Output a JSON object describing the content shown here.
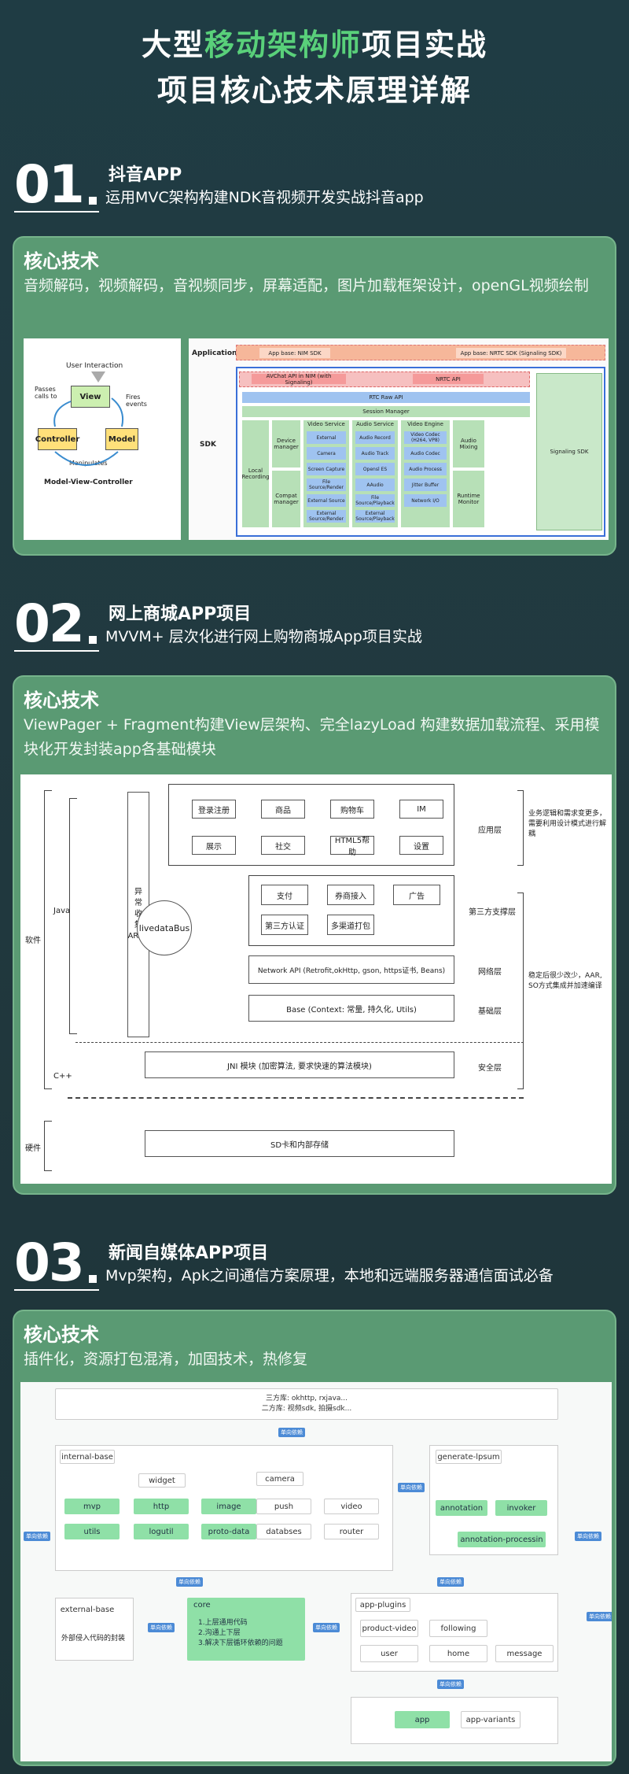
{
  "header": {
    "line1_pre": "大型",
    "line1_hl": "移动架构师",
    "line1_post": "项目实战",
    "line2": "项目核心技术原理详解"
  },
  "accent_color": "#59d07a",
  "card_color": "#5a9a73",
  "sections": [
    {
      "number": "01",
      "title": "抖音APP",
      "subtitle": "运用MVC架构构建NDK音视频开发实战抖音app",
      "card_label": "核心技术",
      "card_desc": "音频解码，视频解码，音视频同步，屏幕适配，图片加载框架设计，openGL视频绘制"
    },
    {
      "number": "02",
      "title": "网上商城APP项目",
      "subtitle": "MVVM+ 层次化进行网上购物商城App项目实战",
      "card_label": "核心技术",
      "card_desc": "ViewPager + Fragment构建View层架构、完全lazyLoad 构建数据加载流程、采用模块化开发封装app各基础模块"
    },
    {
      "number": "03",
      "title": "新闻自媒体APP项目",
      "subtitle": "Mvp架构，Apk之间通信方案原理，本地和远端服务器通信面试必备",
      "card_label": "核心技术",
      "card_desc": "插件化，资源打包混淆，加固技术，热修复"
    }
  ],
  "mvc": {
    "user_interaction": "User Interaction",
    "view": "View",
    "controller": "Controller",
    "model": "Model",
    "passes": "Passes\ncalls to",
    "fires": "Fires\nevents",
    "manipulates": "Manipulates",
    "caption": "Model-View-Controller"
  },
  "sdk": {
    "application": "Application",
    "app_nim": "App base: NIM SDK",
    "app_nrtc": "App base: NRTC SDK (Signaling SDK)",
    "sdk_label": "SDK",
    "avchat": "AVChat API in NIM (with Signaling)",
    "nrtc_api": "NRTC API",
    "rtc_raw": "RTC Raw API",
    "session": "Session Manager",
    "signaling": "Signaling SDK",
    "local_rec": "Local Recording",
    "device_mgr": "Device manager",
    "compat_mgr": "Compat manager",
    "video_service": "Video Service",
    "audio_service": "Audio Service",
    "video_engine": "Video Engine",
    "audio_mixing": "Audio Mixing",
    "runtime_monitor": "Runtime Monitor",
    "video_items": [
      "External",
      "Camera",
      "Screen Capture",
      "File Source/Render",
      "External Source",
      "External Source/Render"
    ],
    "audio_items": [
      "Audio Record",
      "Audio Track",
      "Opensl ES",
      "AAudio",
      "File Source/Playback",
      "External Source/Playback"
    ],
    "engine_items": [
      "Video Codec (H264, VP8)",
      "Audio Codec",
      "Audio Process",
      "Jitter Buffer",
      "Network I/O"
    ]
  },
  "mall": {
    "software": "软件",
    "hardware": "硬件",
    "java": "Java",
    "cpp": "C++",
    "row1": [
      "登录注册",
      "商品",
      "购物车",
      "IM"
    ],
    "row2": [
      "展示",
      "社交",
      "HTML5帮助",
      "设置"
    ],
    "row3": [
      "支付",
      "券商接入",
      "广告"
    ],
    "row4": [
      "第三方认证",
      "多渠道打包"
    ],
    "acra": "异\n常\n收\n集\nARCA",
    "livedata": "livedataBus",
    "network": "Network API (Retrofit,okHttp, gson, https证书, Beans)",
    "base": "Base (Context: 常量, 持久化, Utils)",
    "jni": "JNI 模块 (加密算法, 要求快速的算法模块)",
    "sd": "SD卡和内部存储",
    "layer_app": "应用层",
    "layer_third": "第三方支撑层",
    "layer_net": "网络层",
    "layer_base": "基础层",
    "layer_sec": "安全层",
    "note1": "业务逻辑和需求变更多，需要利用设计模式进行解耦",
    "note2": "稳定后很少改少，AAR, SO方式集成并加速编译"
  },
  "news": {
    "third_party": "三方库: okhttp, rxjava...\n二方库: 视频sdk, 拍摄sdk...",
    "dep": "单向依赖",
    "internal_base": "internal-base",
    "widget": "widget",
    "camera": "camera",
    "generate": "generate-lpsum",
    "ib_row1": [
      "mvp",
      "http",
      "image",
      "push",
      "video"
    ],
    "ib_row2": [
      "utils",
      "logutil",
      "proto-data",
      "databses",
      "router"
    ],
    "gen_row1": [
      "annotation",
      "invoker"
    ],
    "gen_row2": "annotation-processin",
    "external_base": "external-base",
    "external_desc": "外部侵入代码的封装",
    "core": "core",
    "core_items": "1.上层通用代码\n2.沟通上下层\n3.解决下层循环依赖的问题",
    "app_plugins": "app-plugins",
    "plugins": [
      "product-video",
      "following",
      "user",
      "home",
      "message"
    ],
    "app": "app",
    "app_variants": "app-variants"
  }
}
